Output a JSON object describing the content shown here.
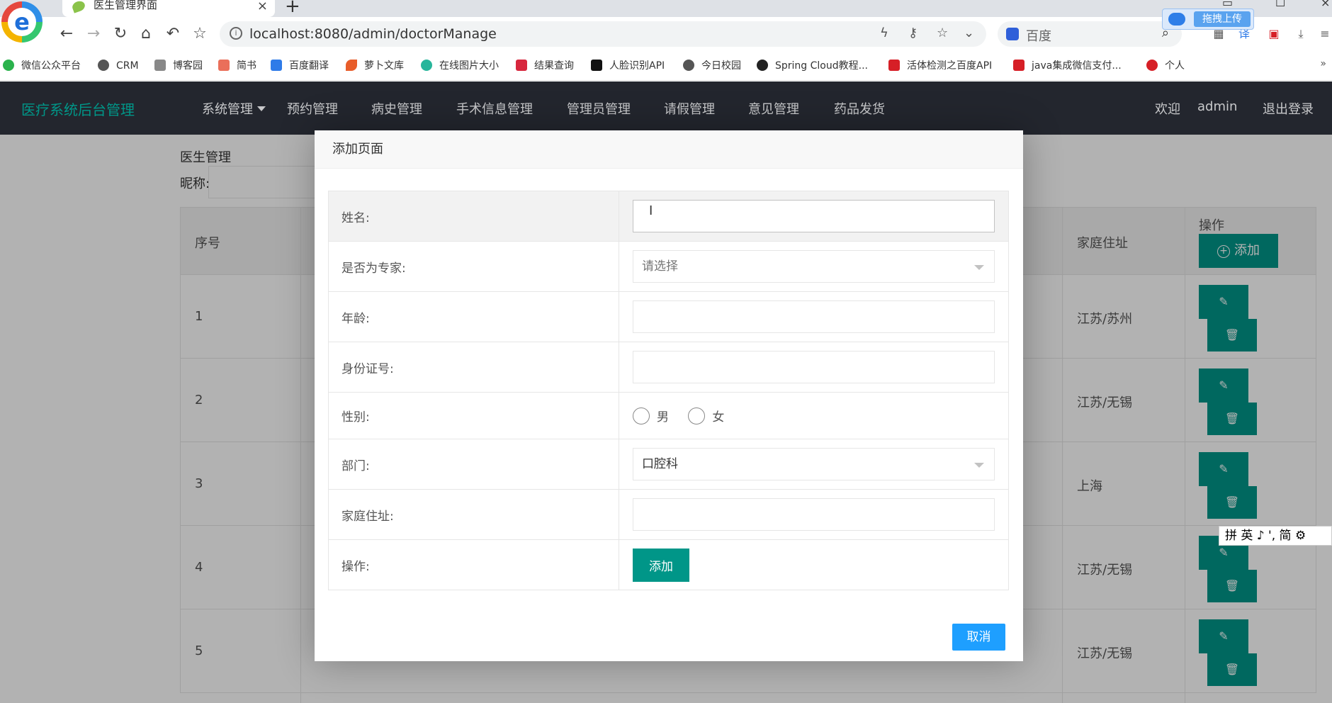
{
  "browser": {
    "tab_title": "医生管理界面",
    "tab_close": "×",
    "new_tab": "+",
    "url": "localhost:8080/admin/doctorManage",
    "search_placeholder": "百度",
    "upload_label": "拖拽上传",
    "logo_letter": "e"
  },
  "bookmarks": [
    {
      "label": "微信公众平台",
      "color": "#2bb24c"
    },
    {
      "label": "CRM",
      "color": "#555555"
    },
    {
      "label": "博客园",
      "color": "#555555"
    },
    {
      "label": "简书",
      "color": "#ea6f5a"
    },
    {
      "label": "百度翻译",
      "color": "#2f7be8"
    },
    {
      "label": "萝卜文库",
      "color": "#e85d2a"
    },
    {
      "label": "在线图片大小",
      "color": "#27b59b"
    },
    {
      "label": "结果查询",
      "color": "#d7263d"
    },
    {
      "label": "人脸识别API",
      "color": "#111111"
    },
    {
      "label": "今日校园",
      "color": "#555555"
    },
    {
      "label": "Spring Cloud教程...",
      "color": "#222222"
    },
    {
      "label": "活体检测之百度API",
      "color": "#d61f26"
    },
    {
      "label": "java集成微信支付...",
      "color": "#d61f26"
    },
    {
      "label": "个人",
      "color": "#d61f26"
    }
  ],
  "bookmarks_more": "»",
  "header": {
    "brand": "医疗系统后台管理",
    "menu": [
      "系统管理",
      "预约管理",
      "病史管理",
      "手术信息管理",
      "管理员管理",
      "请假管理",
      "意见管理",
      "药品发货"
    ],
    "welcome": "欢迎",
    "user": "admin",
    "logout": "退出登录"
  },
  "page": {
    "breadcrumb": "医生管理",
    "filter_label": "昵称:",
    "col_index": "序号",
    "col_address": "家庭住址",
    "col_ops": "操作",
    "add_label": "添加",
    "rows": [
      {
        "num": "1",
        "address": "江苏/苏州"
      },
      {
        "num": "2",
        "address": "江苏/无锡"
      },
      {
        "num": "3",
        "address": "上海"
      },
      {
        "num": "4",
        "address": "江苏/无锡"
      },
      {
        "num": "5",
        "address": "江苏/无锡"
      }
    ]
  },
  "modal": {
    "title": "添加页面",
    "fields": {
      "name": "姓名:",
      "expert": "是否为专家:",
      "expert_placeholder": "请选择",
      "age": "年龄:",
      "id_card": "身份证号:",
      "gender": "性别:",
      "male": "男",
      "female": "女",
      "department": "部门:",
      "department_value": "口腔科",
      "address": "家庭住址:",
      "operation": "操作:"
    },
    "add_button": "添加",
    "cancel_button": "取消"
  },
  "ime": "拼 英 ♪ ', 简 ⚙",
  "colors": {
    "primary": "#009688",
    "header_bg": "#23262e",
    "cancel": "#1e9fff"
  }
}
